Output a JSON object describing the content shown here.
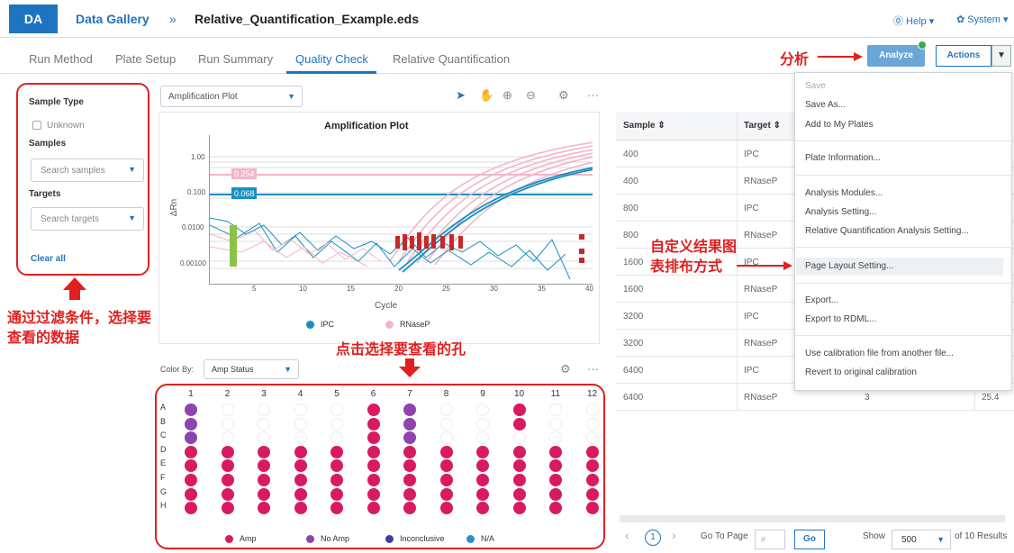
{
  "header": {
    "logo": "DA",
    "breadcrumb_link": "Data Gallery",
    "breadcrumb_sep": "»",
    "file_name": "Relative_Quantification_Example.eds",
    "help": "⓪ Help ▾",
    "system": "✿ System ▾"
  },
  "tabs": [
    {
      "label": "Run Method"
    },
    {
      "label": "Plate Setup"
    },
    {
      "label": "Run Summary"
    },
    {
      "label": "Quality Check"
    },
    {
      "label": "Relative Quantification"
    }
  ],
  "toolbar": {
    "analyze_label": "Analyze",
    "actions_label": "Actions",
    "analyze_note": "分析"
  },
  "filters": {
    "sample_type_label": "Sample Type",
    "unknown_label": "Unknown",
    "samples_label": "Samples",
    "samples_placeholder": "Search samples",
    "targets_label": "Targets",
    "targets_placeholder": "Search targets",
    "clear_all": "Clear all",
    "note": "通过过滤条件，选择要查看的数据"
  },
  "plot": {
    "selector": "Amplification Plot",
    "title": "Amplification Plot",
    "ylabel": "ΔRn",
    "xlabel": "Cycle",
    "y_ticks": [
      "1.00",
      "0.100",
      "0.0100",
      "0.00100"
    ],
    "x_ticks": [
      "5",
      "10",
      "15",
      "20",
      "25",
      "30",
      "35",
      "40"
    ],
    "threshold_ipc": "0.068",
    "threshold_rnase": "0.254",
    "legend": [
      {
        "name": "IPC",
        "color": "#1a8fc0"
      },
      {
        "name": "RNaseP",
        "color": "#f2b6c6"
      }
    ],
    "color_by_label": "Color By:",
    "color_by_value": "Amp Status"
  },
  "plate": {
    "note": "点击选择要查看的孔",
    "columns": [
      "1",
      "2",
      "3",
      "4",
      "5",
      "6",
      "7",
      "8",
      "9",
      "10",
      "11",
      "12"
    ],
    "rows": [
      "A",
      "B",
      "C",
      "D",
      "E",
      "F",
      "G",
      "H"
    ],
    "colors": {
      "amp": "#d81b60",
      "noamp": "#8e44ad",
      "empty": "#ffffff"
    },
    "legend": [
      {
        "label": "Amp",
        "color": "#d81b60"
      },
      {
        "label": "No Amp",
        "color": "#8e44ad"
      },
      {
        "label": "Inconclusive",
        "color": "#3a3fa0"
      },
      {
        "label": "N/A",
        "color": "#2a8fcf"
      }
    ]
  },
  "table": {
    "columns": [
      "Sample ⇕",
      "Target ⇕"
    ],
    "rows": [
      {
        "sample": "400",
        "target": "IPC",
        "extra": ""
      },
      {
        "sample": "400",
        "target": "RNaseP",
        "extra": ""
      },
      {
        "sample": "800",
        "target": "IPC",
        "extra": ""
      },
      {
        "sample": "800",
        "target": "RNaseP",
        "extra": ""
      },
      {
        "sample": "1600",
        "target": "IPC",
        "extra": ""
      },
      {
        "sample": "1600",
        "target": "RNaseP",
        "extra": ""
      },
      {
        "sample": "3200",
        "target": "IPC",
        "extra": ""
      },
      {
        "sample": "3200",
        "target": "RNaseP",
        "extra": ""
      },
      {
        "sample": "6400",
        "target": "IPC",
        "extra": ""
      },
      {
        "sample": "6400",
        "target": "RNaseP",
        "extra": "3",
        "extra2": "25.4"
      }
    ],
    "pager": {
      "page": "1",
      "goto_label": "Go To Page",
      "goto_placeholder": "#",
      "go": "Go",
      "show_label": "Show",
      "show_value": "500",
      "results": "of 10 Results"
    }
  },
  "menu": {
    "items": [
      {
        "label": "Save",
        "disabled": true
      },
      {
        "label": "Save As...",
        "disabled": false
      },
      {
        "label": "Add to My Plates",
        "disabled": false
      },
      {
        "label": "Plate Information...",
        "disabled": false
      },
      {
        "label": "Analysis Modules...",
        "disabled": false
      },
      {
        "label": "Analysis Setting...",
        "disabled": false
      },
      {
        "label": "Relative Quantification Analysis Setting...",
        "disabled": false
      },
      {
        "label": "Page Layout Setting...",
        "disabled": false
      },
      {
        "label": "Export...",
        "disabled": false
      },
      {
        "label": "Export to RDML...",
        "disabled": false
      },
      {
        "label": "Use calibration file from another file...",
        "disabled": false
      },
      {
        "label": "Revert to original calibration",
        "disabled": false
      }
    ],
    "layout_note": "自定义结果图表排布方式"
  }
}
